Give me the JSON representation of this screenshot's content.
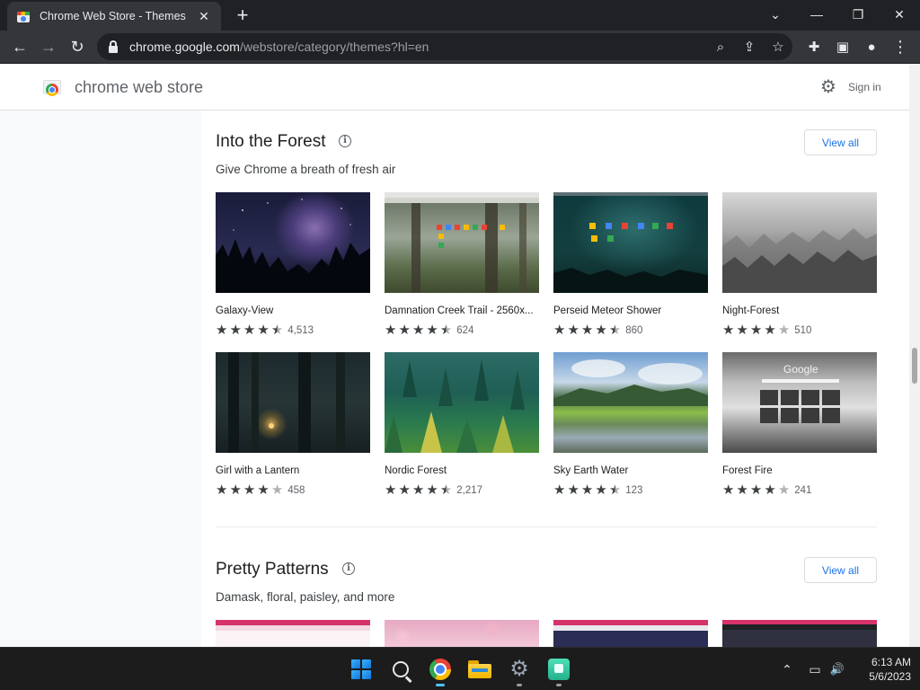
{
  "browser": {
    "tab_title": "Chrome Web Store - Themes",
    "tab_close_glyph": "✕",
    "new_tab_glyph": "+",
    "url_host": "chrome.google.com",
    "url_path": "/webstore/category/themes?hl=en",
    "window_controls": {
      "dropdown": "⌄",
      "minimize": "—",
      "restore": "❐",
      "close": "✕"
    },
    "nav_glyphs": {
      "back": "←",
      "forward": "→",
      "reload": "↻"
    },
    "toolbar_glyphs": {
      "zoom": "⌕",
      "share": "⇪",
      "bookmark": "☆",
      "extensions": "✚",
      "side_panel": "▣",
      "profile": "●",
      "menu": "⋮"
    }
  },
  "header": {
    "title": "chrome web store",
    "settings_glyph": "⚙",
    "sign_in": "Sign in"
  },
  "sections": [
    {
      "title": "Into the Forest",
      "info_glyph": "i",
      "subtitle": "Give Chrome a breath of fresh air",
      "view_all": "View all",
      "themes": [
        {
          "name": "Galaxy-View",
          "stars": 4.5,
          "count": "4,513"
        },
        {
          "name": "Damnation Creek Trail - 2560x...",
          "stars": 4.5,
          "count": "624"
        },
        {
          "name": "Perseid Meteor Shower",
          "stars": 4.5,
          "count": "860"
        },
        {
          "name": "Night-Forest",
          "stars": 4,
          "count": "510"
        },
        {
          "name": "Girl with a Lantern",
          "stars": 4,
          "count": "458"
        },
        {
          "name": "Nordic Forest",
          "stars": 4.5,
          "count": "2,217"
        },
        {
          "name": "Sky Earth Water",
          "stars": 4.5,
          "count": "123"
        },
        {
          "name": "Forest Fire",
          "stars": 4,
          "count": "241"
        }
      ]
    },
    {
      "title": "Pretty Patterns",
      "info_glyph": "i",
      "subtitle": "Damask, floral, paisley, and more",
      "view_all": "View all"
    }
  ],
  "forest_fire_overlay": "Google",
  "colors": {
    "link_blue": "#1a73e8",
    "browser_dark": "#202124",
    "toolbar_dark": "#35363a",
    "star_on": "#3c4043",
    "star_off": "#b0b0b0"
  },
  "taskbar": {
    "apps": [
      "windows-start",
      "search",
      "chrome",
      "file-explorer",
      "settings",
      "app"
    ],
    "tray": {
      "chevron": "⌃",
      "network": "▭",
      "volume": "🔊"
    },
    "time": "6:13 AM",
    "date": "5/6/2023"
  }
}
